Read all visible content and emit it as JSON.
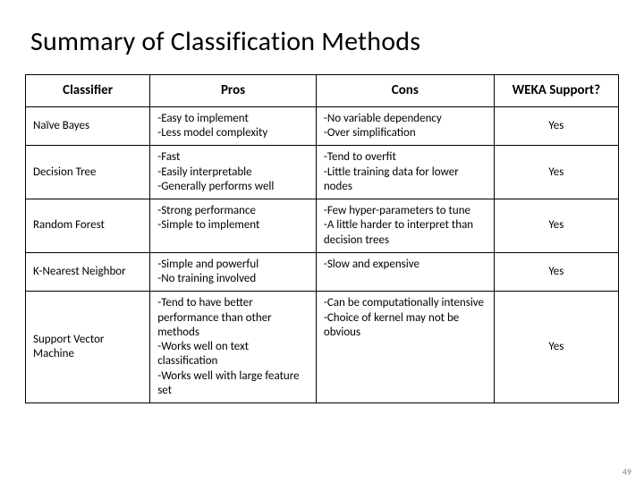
{
  "title": "Summary of Classification Methods",
  "headers": {
    "classifier": "Classifier",
    "pros": "Pros",
    "cons": "Cons",
    "weka": "WEKA Support?"
  },
  "rows": [
    {
      "name": "Naïve Bayes",
      "pros": "-Easy to implement\n-Less model complexity",
      "cons": "-No variable dependency\n-Over simplification",
      "weka": "Yes"
    },
    {
      "name": "Decision Tree",
      "pros": "-Fast\n-Easily interpretable\n-Generally performs well",
      "cons": "-Tend to overfit\n-Little training data for lower nodes",
      "weka": "Yes"
    },
    {
      "name": "Random Forest",
      "pros": "-Strong performance\n-Simple to implement",
      "cons": "-Few hyper-parameters to tune\n-A little harder to interpret than decision trees",
      "weka": "Yes"
    },
    {
      "name": "K-Nearest Neighbor",
      "pros": "-Simple and powerful\n-No training involved",
      "cons": "-Slow and expensive",
      "weka": "Yes"
    },
    {
      "name": "Support Vector Machine",
      "pros": "-Tend to have better performance than other methods\n-Works well on text classification\n-Works well with large feature set",
      "cons": "-Can be computationally intensive\n-Choice of kernel may not be obvious",
      "weka": "Yes"
    }
  ],
  "page_number": "49"
}
